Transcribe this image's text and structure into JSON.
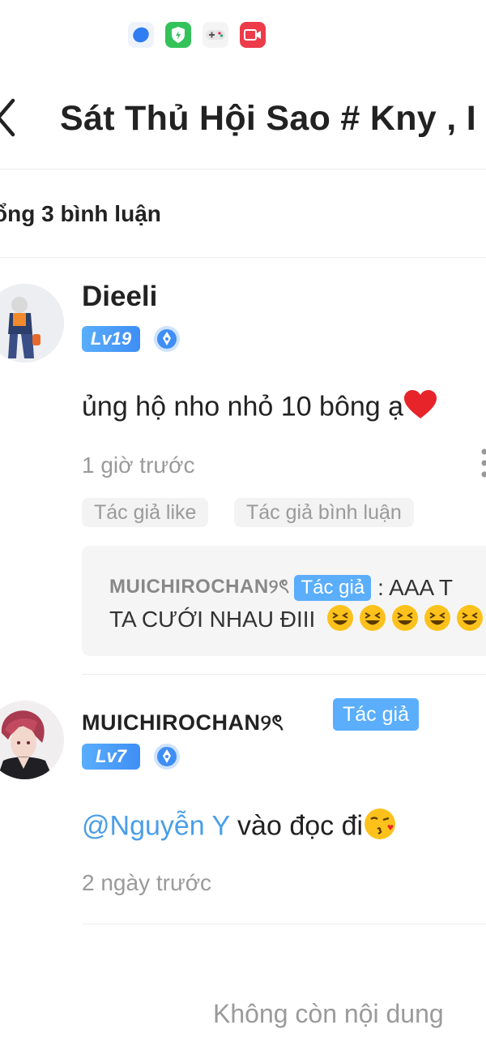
{
  "status_icons": [
    "blue-app-icon",
    "green-shield-app-icon",
    "game-controller-icon",
    "red-video-app-icon"
  ],
  "header": {
    "back_icon": "chevron-left-icon",
    "title": "Sát Thủ Hội Sao # Kny , I"
  },
  "total_comments_label": "ổng 3 bình luận",
  "comments": [
    {
      "username": "Dieeli",
      "level": "Lv19",
      "medal_icon": "pen-medal-icon",
      "text": "ủng hộ nho nhỏ 10 bông ạ",
      "text_emoji": "red-heart",
      "time": "1 giờ trước",
      "chips": [
        "Tác giả like",
        "Tác giả bình luận"
      ],
      "reply": {
        "username": "MUICHIROCHAN୨ৎ",
        "author_tag": "Tác giả",
        "text_line1": ": AAA T",
        "text_line2": "TA CƯỚI NHAU ĐIII"
      }
    },
    {
      "username": "MUICHIROCHAN୨ৎ",
      "author_tag": "Tác giả",
      "level": "Lv7",
      "medal_icon": "pen-medal-icon",
      "mention": "@Nguyễn Y",
      "text": " vào đọc đi",
      "text_emoji": "kissing-face",
      "time": "2 ngày trước"
    }
  ],
  "footer": {
    "no_more_text": "Không còn nội dung"
  },
  "colors": {
    "accent_blue": "#5aaefc",
    "mention_blue": "#4a9ee8",
    "muted_gray": "#9a9a9a",
    "chip_bg": "#f3f3f3",
    "reply_bg": "#f5f5f5"
  }
}
